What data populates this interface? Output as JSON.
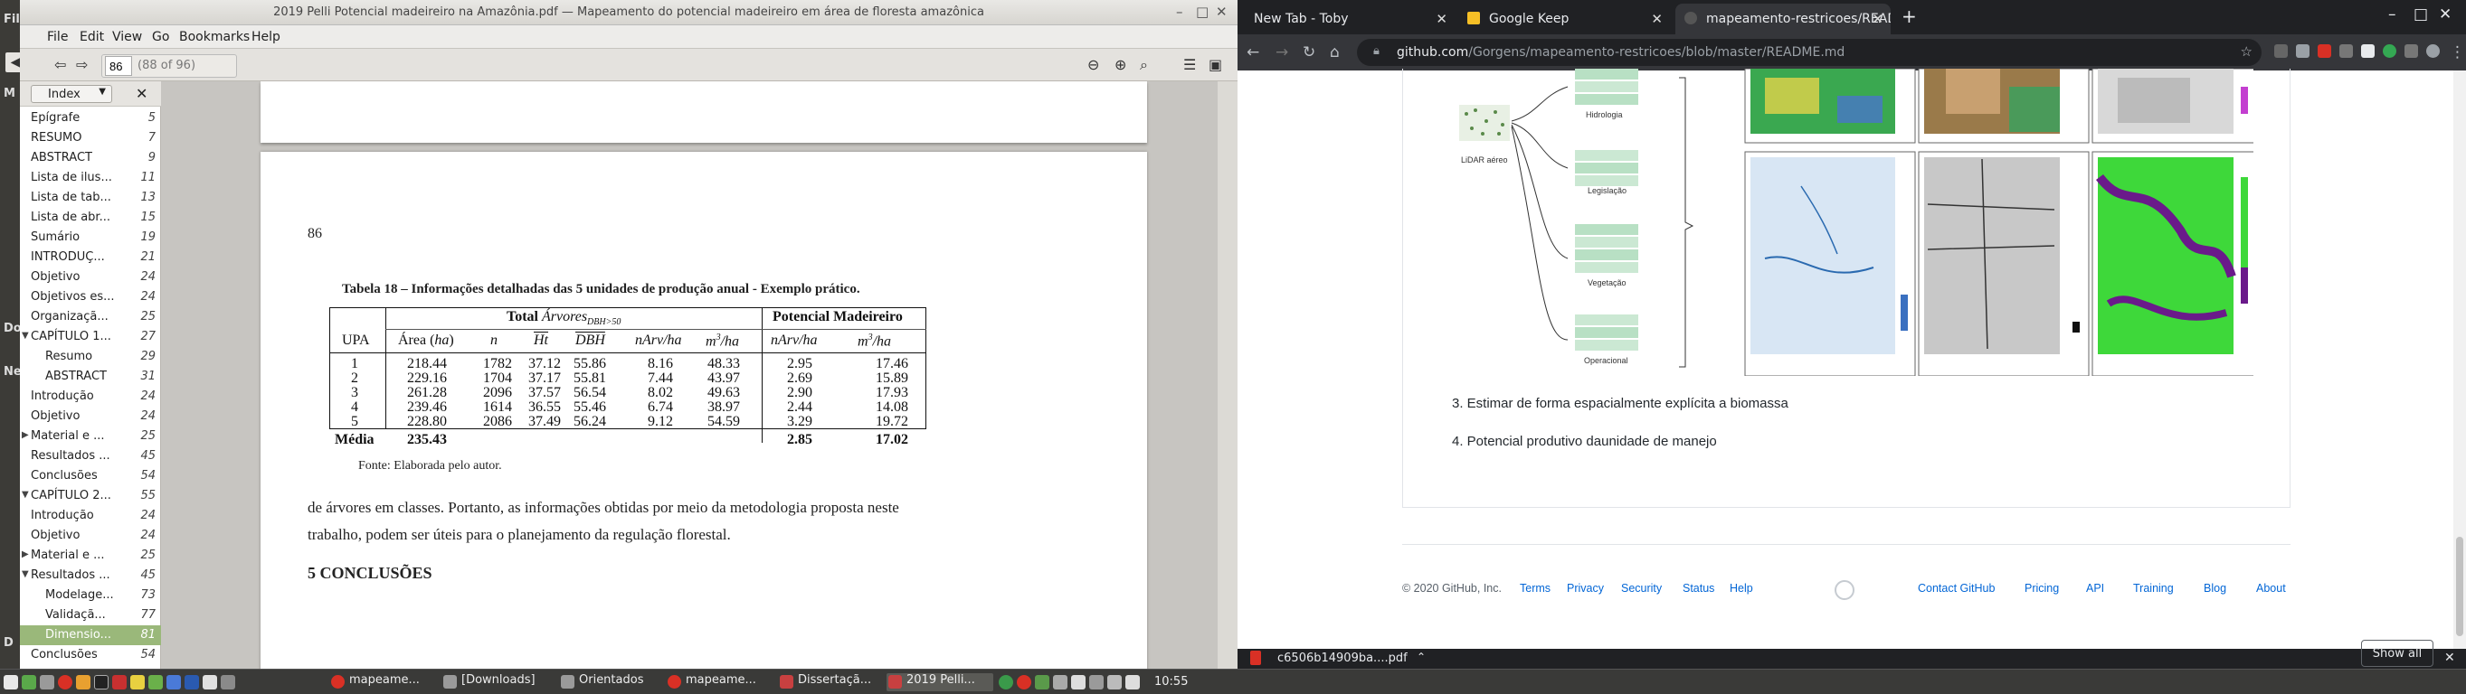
{
  "desktop": {
    "left_labels": [
      "File",
      "M",
      "Do",
      "Ne",
      "D"
    ]
  },
  "evince": {
    "title": "2019 Pelli Potencial madeireiro na Amazônia.pdf — Mapeamento do potencial madeireiro em área de floresta amazônica",
    "menu": [
      "File",
      "Edit",
      "View",
      "Go",
      "Bookmarks",
      "Help"
    ],
    "page_number": "86",
    "page_count": "(88 of 96)",
    "sidebar": {
      "mode": "Index",
      "items": [
        {
          "label": "Epígrafe",
          "page": "5"
        },
        {
          "label": "RESUMO",
          "page": "7"
        },
        {
          "label": "ABSTRACT",
          "page": "9"
        },
        {
          "label": "Lista de ilus...",
          "page": "11"
        },
        {
          "label": "Lista de tab...",
          "page": "13"
        },
        {
          "label": "Lista de abr...",
          "page": "15"
        },
        {
          "label": "Sumário",
          "page": "19"
        },
        {
          "label": "INTRODUÇ...",
          "page": "21"
        },
        {
          "label": "Objetivo",
          "page": "24"
        },
        {
          "label": "Objetivos es...",
          "page": "24"
        },
        {
          "label": "Organizaçã...",
          "page": "25"
        },
        {
          "label": "CAPÍTULO 1...",
          "page": "27"
        },
        {
          "label": "Resumo",
          "page": "29"
        },
        {
          "label": "ABSTRACT",
          "page": "31"
        },
        {
          "label": "Introdução",
          "page": "24"
        },
        {
          "label": "Objetivo",
          "page": "24"
        },
        {
          "label": "Material e ...",
          "page": "25"
        },
        {
          "label": "Resultados ...",
          "page": "45"
        },
        {
          "label": "Conclusões",
          "page": "54"
        },
        {
          "label": "CAPÍTULO 2...",
          "page": "55"
        },
        {
          "label": "Introdução",
          "page": "24"
        },
        {
          "label": "Objetivo",
          "page": "24"
        },
        {
          "label": "Material e ...",
          "page": "25"
        },
        {
          "label": "Resultados ...",
          "page": "45"
        },
        {
          "label": "Modelage...",
          "page": "73"
        },
        {
          "label": "Validaçã...",
          "page": "77"
        },
        {
          "label": "Dimensio...",
          "page": "81"
        },
        {
          "label": "Conclusões",
          "page": "54"
        }
      ]
    },
    "doc": {
      "page_num": "86",
      "table_caption": "Tabela 18 – Informações detalhadas das 5 unidades de produção anual - Exemplo prático.",
      "group_total_prefix": "Total ",
      "group_total_var": "Árvores",
      "group_total_sub": "DBH>50",
      "group_potencial": "Potencial Madeireiro",
      "col_upa": "UPA",
      "col_area": "Área (",
      "col_area_unit": "ha",
      "col_area_close": ")",
      "col_n": "n",
      "col_ht": "Ht",
      "col_dbh": "DBH",
      "col_narvha": "nArv/ha",
      "col_m3_a": "m",
      "col_m3_b": "3",
      "col_m3_c": "/ha",
      "col_p_narvha": "nArv/ha",
      "col_p_m3_a": "m",
      "col_p_m3_b": "3",
      "col_p_m3_c": "/ha",
      "rows": [
        [
          "1",
          "218.44",
          "1782",
          "37.12",
          "55.86",
          "8.16",
          "48.33",
          "2.95",
          "17.46"
        ],
        [
          "2",
          "229.16",
          "1704",
          "37.17",
          "55.81",
          "7.44",
          "43.97",
          "2.69",
          "15.89"
        ],
        [
          "3",
          "261.28",
          "2096",
          "37.57",
          "56.54",
          "8.02",
          "49.63",
          "2.90",
          "17.93"
        ],
        [
          "4",
          "239.46",
          "1614",
          "36.55",
          "55.46",
          "6.74",
          "38.97",
          "2.44",
          "14.08"
        ],
        [
          "5",
          "228.80",
          "2086",
          "37.49",
          "56.24",
          "9.12",
          "54.59",
          "3.29",
          "19.72"
        ]
      ],
      "media_label": "Média",
      "media_area": "235.43",
      "media_p_narv": "2.85",
      "media_p_m3": "17.02",
      "fonte": "Fonte: Elaborada pelo autor.",
      "para_line1": "de árvores em classes. Portanto, as informações obtidas por meio da metodologia proposta neste",
      "para_line2": "trabalho, podem ser úteis para o planejamento da regulação florestal.",
      "section": "5  CONCLUSÕES"
    }
  },
  "chrome": {
    "tabs": [
      {
        "label": "New Tab - Toby"
      },
      {
        "label": "Google Keep"
      },
      {
        "label": "mapeamento-restricoes/README"
      }
    ],
    "url_host": "github.com",
    "url_path": "/Gorgens/mapeamento-restricoes/blob/master/README.md",
    "fig_labels": {
      "lidar": "LiDAR aéreo",
      "hidro": "Hidrologia",
      "legis": "Legislação",
      "veg": "Vegetação",
      "oper": "Operacional"
    },
    "list": [
      "3. Estimar de forma espacialmente explícita a biomassa",
      "4. Potencial produtivo daunidade de manejo"
    ],
    "footer": {
      "copyright": "© 2020 GitHub, Inc.",
      "left_links": [
        "Terms",
        "Privacy",
        "Security",
        "Status",
        "Help"
      ],
      "right_links": [
        "Contact GitHub",
        "Pricing",
        "API",
        "Training",
        "Blog",
        "About"
      ]
    },
    "download": {
      "file": "c6506b14909ba....pdf",
      "show_all": "Show all"
    }
  },
  "taskbar": {
    "items": [
      "mapeame...",
      "[Downloads]",
      "Orientados",
      "mapeame...",
      "Dissertaçã...",
      "2019 Pelli..."
    ],
    "clock": "10:55"
  },
  "colors": {
    "accent_green": "#9ab87a",
    "gh_link": "#0366d6",
    "chrome_dark": "#202124"
  }
}
